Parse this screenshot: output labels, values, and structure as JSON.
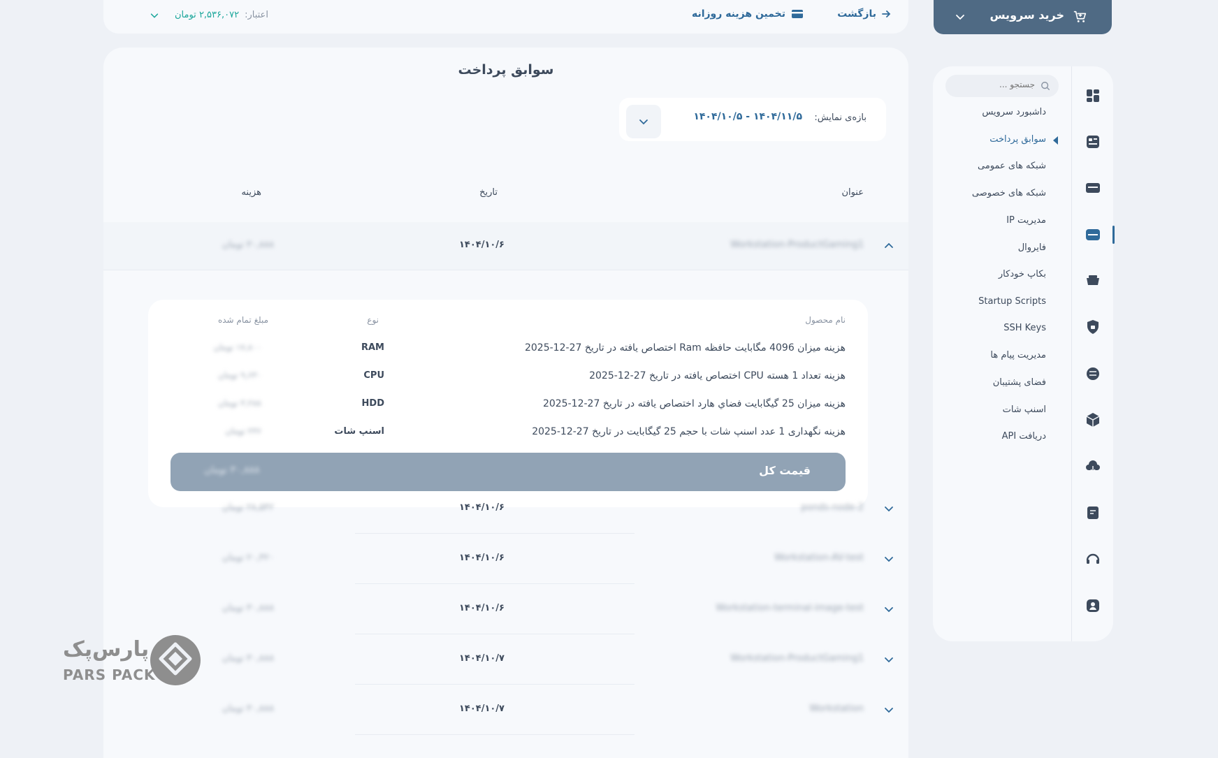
{
  "buy_button": {
    "label": "خرید سرویس"
  },
  "topbar": {
    "back_label": "بازگشت",
    "estimate_label": "تخمین هزینه روزانه",
    "credit_label": "اعتبار:",
    "credit_value": "۲,۵۳۶,۰۷۲ تومان"
  },
  "sidebar": {
    "search_placeholder": "جستجو ...",
    "items": [
      {
        "label": "داشبورد سرویس"
      },
      {
        "label": "سوابق پرداخت"
      },
      {
        "label": "شبکه های عمومی"
      },
      {
        "label": "شبکه های خصوصی"
      },
      {
        "label": "مدیریت IP"
      },
      {
        "label": "فایروال"
      },
      {
        "label": "بکاپ خودکار"
      },
      {
        "label": "Startup Scripts"
      },
      {
        "label": "SSH Keys"
      },
      {
        "label": "مدیریت پیام ها"
      },
      {
        "label": "فضای پشتیبان"
      },
      {
        "label": "اسنپ شات"
      },
      {
        "label": "دریافت API"
      }
    ],
    "icons": [
      "dashboard-icon",
      "payment-history-icon",
      "public-network-icon",
      "private-network-icon",
      "ip-management-icon",
      "firewall-icon",
      "auto-backup-icon",
      "startup-scripts-icon",
      "ssh-keys-icon",
      "messages-icon",
      "backup-storage-icon",
      "snapshot-icon",
      "api-icon"
    ]
  },
  "main": {
    "title": "سوابق پرداخت",
    "range_label": "بازه‌ی نمایش:",
    "range_value": "۱۴۰۴/۱۱/۵ - ۱۴۰۴/۱۰/۵",
    "columns": {
      "title": "عنوان",
      "date": "تاریخ",
      "cost": "هزینه"
    },
    "rows": [
      {
        "title": "Workstation-ProductGaming1",
        "date": "۱۴۰۴/۱۰/۶",
        "cost": "۳۰,۸۸۸ تومان"
      },
      {
        "title": "ponds-node-2",
        "date": "۱۴۰۴/۱۰/۶",
        "cost": "۲۸,۵۴۲ تومان"
      },
      {
        "title": "Workstation-AV-test",
        "date": "۱۴۰۴/۱۰/۶",
        "cost": "۲۰,۳۲۰ تومان"
      },
      {
        "title": "Workstation-terminal-image-test",
        "date": "۱۴۰۴/۱۰/۶",
        "cost": "۳۰,۸۸۸ تومان"
      },
      {
        "title": "Workstation-ProductGaming1",
        "date": "۱۴۰۴/۱۰/۷",
        "cost": "۳۰,۸۸۸ تومان"
      },
      {
        "title": "Workstation",
        "date": "۱۴۰۴/۱۰/۷",
        "cost": "۳۰,۸۸۸ تومان"
      }
    ],
    "detail": {
      "columns": {
        "name": "نام محصول",
        "type": "نوع",
        "amount": "مبلغ تمام شده"
      },
      "items": [
        {
          "name": "هزینه میزان 4096 مگابایت حافظه Ram اختصاص یافته در تاریخ 27-12-2025",
          "type": "RAM",
          "amount": "۱۷,۸۰۰ تومان"
        },
        {
          "name": "هزینه تعداد 1 هسته CPU اختصاص یافته در تاریخ 27-12-2025",
          "type": "CPU",
          "amount": "۹,۶۳۰ تومان"
        },
        {
          "name": "هزینه میزان 25 گیگابایت فضاي هارد اختصاص یافته در تاریخ 27-12-2025",
          "type": "HDD",
          "amount": "۳,۲۸۸ تومان"
        },
        {
          "name": "هزینه نگهداری 1 عدد اسنپ شات با حجم 25 گیگابایت در تاریخ 27-12-2025",
          "type": "اسنپ شات",
          "amount": "۲۳۶ تومان"
        }
      ],
      "total_label": "قیمت کل",
      "total_value": "۳۰,۸۸۸ تومان"
    }
  },
  "logo": {
    "fa": "پارس‌پک",
    "en": "PARS PACK"
  }
}
